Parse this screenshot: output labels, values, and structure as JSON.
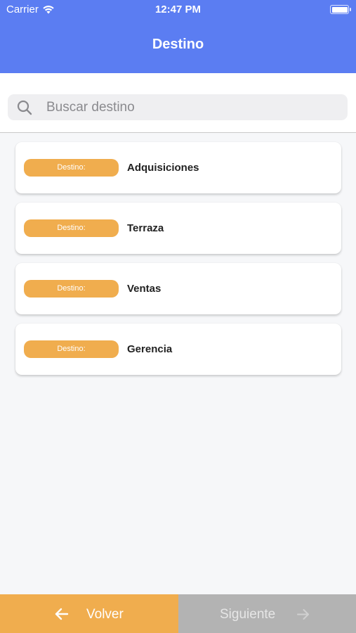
{
  "status_bar": {
    "carrier": "Carrier",
    "time": "12:47 PM",
    "wifi_icon": "wifi-icon",
    "battery_icon": "battery-icon"
  },
  "header": {
    "title": "Destino",
    "color": "#5b7df2"
  },
  "search": {
    "placeholder": "Buscar destino",
    "value": "",
    "icon": "search-icon"
  },
  "destinations": [
    {
      "badge": "Destino:",
      "name": "Adquisiciones"
    },
    {
      "badge": "Destino:",
      "name": "Terraza"
    },
    {
      "badge": "Destino:",
      "name": "Ventas"
    },
    {
      "badge": "Destino:",
      "name": "Gerencia"
    }
  ],
  "footer": {
    "back_label": "Volver",
    "back_icon": "arrow-left-icon",
    "next_label": "Siguiente",
    "next_icon": "arrow-right-icon",
    "back_color": "#f0ad4e",
    "next_color": "#b3b3b3"
  },
  "colors": {
    "accent": "#f0ad4e",
    "background": "#f6f7f9"
  }
}
